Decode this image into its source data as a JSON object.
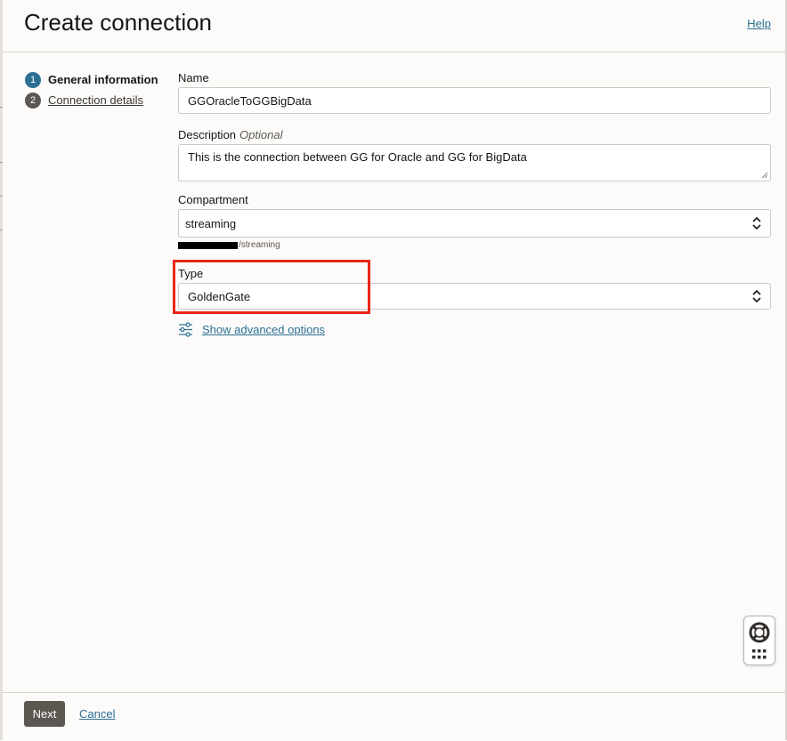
{
  "header": {
    "title": "Create connection",
    "help_label": "Help"
  },
  "steps": [
    {
      "number": "1",
      "label": "General information",
      "state": "current"
    },
    {
      "number": "2",
      "label": "Connection details",
      "state": "pending"
    }
  ],
  "form": {
    "name": {
      "label": "Name",
      "value": "GGOracleToGGBigData"
    },
    "description": {
      "label": "Description",
      "optional_label": "Optional",
      "value": "This is the connection between GG for Oracle and GG for BigData"
    },
    "compartment": {
      "label": "Compartment",
      "value": "streaming",
      "path_suffix": "/streaming"
    },
    "type": {
      "label": "Type",
      "value": "GoldenGate"
    },
    "advanced_options_label": "Show advanced options"
  },
  "footer": {
    "next_label": "Next",
    "cancel_label": "Cancel"
  },
  "colors": {
    "accent": "#2c6f92",
    "highlight": "#e8261a",
    "primary_button": "#5c5751"
  },
  "icons": {
    "advanced_options": "sliders-icon",
    "help_lifebuoy": "lifebuoy-icon",
    "apps_grid": "grid-icon"
  }
}
